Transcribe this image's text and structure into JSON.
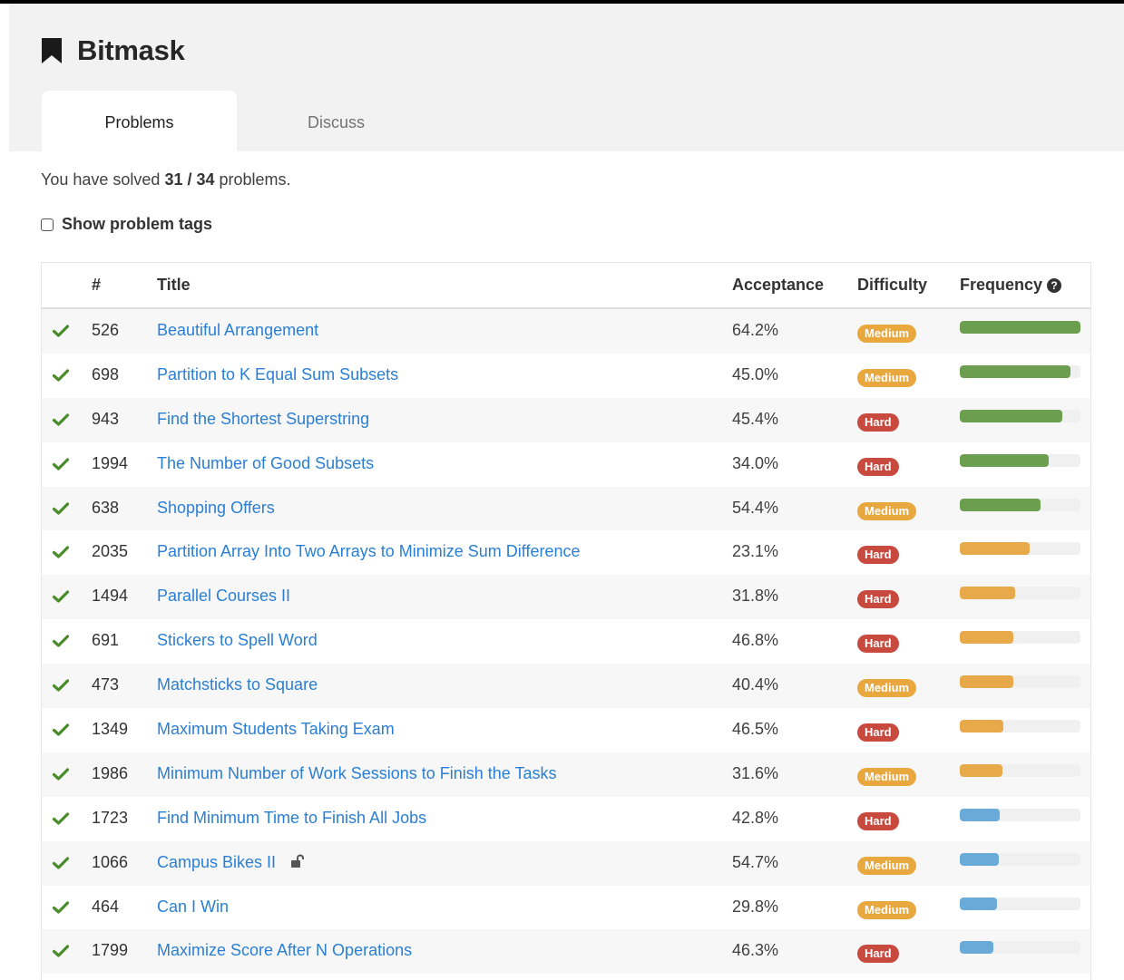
{
  "header": {
    "title": "Bitmask",
    "tabs": [
      {
        "label": "Problems",
        "active": true
      },
      {
        "label": "Discuss",
        "active": false
      }
    ]
  },
  "summary": {
    "prefix": "You have solved ",
    "solved": "31 / 34",
    "suffix": " problems."
  },
  "tags_toggle": {
    "label": "Show problem tags",
    "checked": false
  },
  "table": {
    "columns": {
      "number": "#",
      "title": "Title",
      "acceptance": "Acceptance",
      "difficulty": "Difficulty",
      "frequency": "Frequency"
    },
    "difficulty_colors": {
      "Medium": "#e8a83e",
      "Hard": "#c8493e"
    },
    "frequency_colors": {
      "high": "#6c9e4f",
      "mid": "#e8a94a",
      "low": "#6aaad9"
    },
    "rows": [
      {
        "num": "526",
        "title": "Beautiful Arrangement",
        "acceptance": "64.2%",
        "difficulty": "Medium",
        "frequency": 1.0,
        "freq_level": "high",
        "locked": false,
        "solved": true
      },
      {
        "num": "698",
        "title": "Partition to K Equal Sum Subsets",
        "acceptance": "45.0%",
        "difficulty": "Medium",
        "frequency": 0.92,
        "freq_level": "high",
        "locked": false,
        "solved": true
      },
      {
        "num": "943",
        "title": "Find the Shortest Superstring",
        "acceptance": "45.4%",
        "difficulty": "Hard",
        "frequency": 0.85,
        "freq_level": "high",
        "locked": false,
        "solved": true
      },
      {
        "num": "1994",
        "title": "The Number of Good Subsets",
        "acceptance": "34.0%",
        "difficulty": "Hard",
        "frequency": 0.74,
        "freq_level": "high",
        "locked": false,
        "solved": true
      },
      {
        "num": "638",
        "title": "Shopping Offers",
        "acceptance": "54.4%",
        "difficulty": "Medium",
        "frequency": 0.67,
        "freq_level": "high",
        "locked": false,
        "solved": true
      },
      {
        "num": "2035",
        "title": "Partition Array Into Two Arrays to Minimize Sum Difference",
        "acceptance": "23.1%",
        "difficulty": "Hard",
        "frequency": 0.58,
        "freq_level": "mid",
        "locked": false,
        "solved": true
      },
      {
        "num": "1494",
        "title": "Parallel Courses II",
        "acceptance": "31.8%",
        "difficulty": "Hard",
        "frequency": 0.46,
        "freq_level": "mid",
        "locked": false,
        "solved": true
      },
      {
        "num": "691",
        "title": "Stickers to Spell Word",
        "acceptance": "46.8%",
        "difficulty": "Hard",
        "frequency": 0.44,
        "freq_level": "mid",
        "locked": false,
        "solved": true
      },
      {
        "num": "473",
        "title": "Matchsticks to Square",
        "acceptance": "40.4%",
        "difficulty": "Medium",
        "frequency": 0.44,
        "freq_level": "mid",
        "locked": false,
        "solved": true
      },
      {
        "num": "1349",
        "title": "Maximum Students Taking Exam",
        "acceptance": "46.5%",
        "difficulty": "Hard",
        "frequency": 0.36,
        "freq_level": "mid",
        "locked": false,
        "solved": true
      },
      {
        "num": "1986",
        "title": "Minimum Number of Work Sessions to Finish the Tasks",
        "acceptance": "31.6%",
        "difficulty": "Medium",
        "frequency": 0.35,
        "freq_level": "mid",
        "locked": false,
        "solved": true
      },
      {
        "num": "1723",
        "title": "Find Minimum Time to Finish All Jobs",
        "acceptance": "42.8%",
        "difficulty": "Hard",
        "frequency": 0.33,
        "freq_level": "low",
        "locked": false,
        "solved": true
      },
      {
        "num": "1066",
        "title": "Campus Bikes II",
        "acceptance": "54.7%",
        "difficulty": "Medium",
        "frequency": 0.32,
        "freq_level": "low",
        "locked": true,
        "solved": true
      },
      {
        "num": "464",
        "title": "Can I Win",
        "acceptance": "29.8%",
        "difficulty": "Medium",
        "frequency": 0.31,
        "freq_level": "low",
        "locked": false,
        "solved": true
      },
      {
        "num": "1799",
        "title": "Maximize Score After N Operations",
        "acceptance": "46.3%",
        "difficulty": "Hard",
        "frequency": 0.28,
        "freq_level": "low",
        "locked": false,
        "solved": true
      }
    ]
  }
}
